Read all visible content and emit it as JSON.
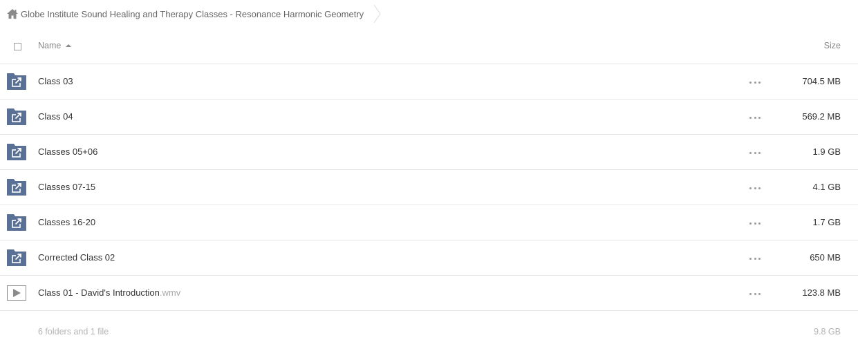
{
  "breadcrumb": {
    "home_icon": "home-icon",
    "current": "Globe Institute Sound Healing and Therapy Classes - Resonance Harmonic Geometry"
  },
  "header": {
    "name_label": "Name",
    "size_label": "Size",
    "sort": "ascending"
  },
  "colors": {
    "folder_icon": "#5a7094",
    "divider": "#e6e6e6",
    "muted_text": "#b3b3b3"
  },
  "files": [
    {
      "name": "Class 03",
      "ext": "",
      "size": "704.5 MB",
      "type": "shared-folder"
    },
    {
      "name": "Class 04",
      "ext": "",
      "size": "569.2 MB",
      "type": "shared-folder"
    },
    {
      "name": "Classes 05+06",
      "ext": "",
      "size": "1.9 GB",
      "type": "shared-folder"
    },
    {
      "name": "Classes 07-15",
      "ext": "",
      "size": "4.1 GB",
      "type": "shared-folder"
    },
    {
      "name": "Classes 16-20",
      "ext": "",
      "size": "1.7 GB",
      "type": "shared-folder"
    },
    {
      "name": "Corrected Class 02",
      "ext": "",
      "size": "650 MB",
      "type": "shared-folder"
    },
    {
      "name": "Class 01 - David's Introduction",
      "ext": ".wmv",
      "size": "123.8 MB",
      "type": "video-file"
    }
  ],
  "footer": {
    "summary": "6 folders and 1 file",
    "total_size": "9.8 GB"
  }
}
